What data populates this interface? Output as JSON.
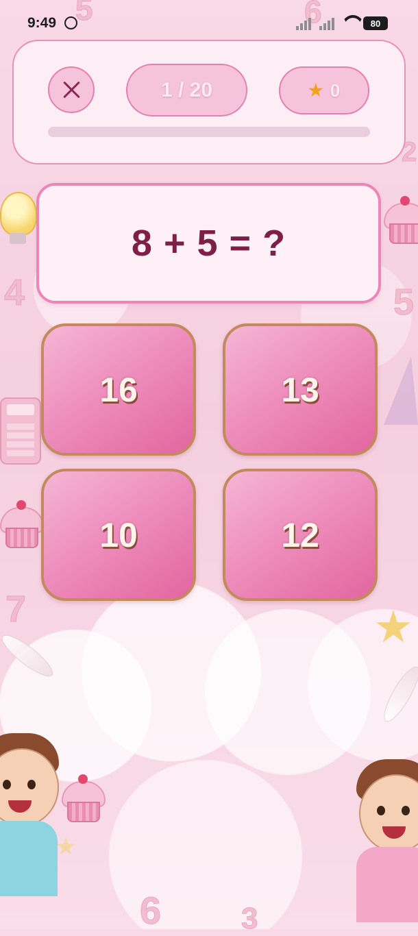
{
  "status_bar": {
    "time": "9:49",
    "battery": "80",
    "icons": [
      "whatsapp-icon",
      "signal-icon",
      "wifi-icon",
      "battery-icon"
    ]
  },
  "header": {
    "close_icon": "close-icon",
    "progress": "1 / 20",
    "score_icon": "star-icon",
    "score": "0",
    "progress_fraction": 0.0
  },
  "question": {
    "text": "8 + 5 = ?"
  },
  "answers": [
    {
      "label": "16"
    },
    {
      "label": "13"
    },
    {
      "label": "10"
    },
    {
      "label": "12"
    }
  ],
  "background_numbers": [
    "5",
    "6",
    "4",
    "5",
    "6",
    "2",
    "3",
    "7"
  ],
  "colors": {
    "accent": "#e67fad",
    "question_text": "#7e1f47",
    "answer_border": "#c28a5d",
    "star": "#f0a21a"
  }
}
